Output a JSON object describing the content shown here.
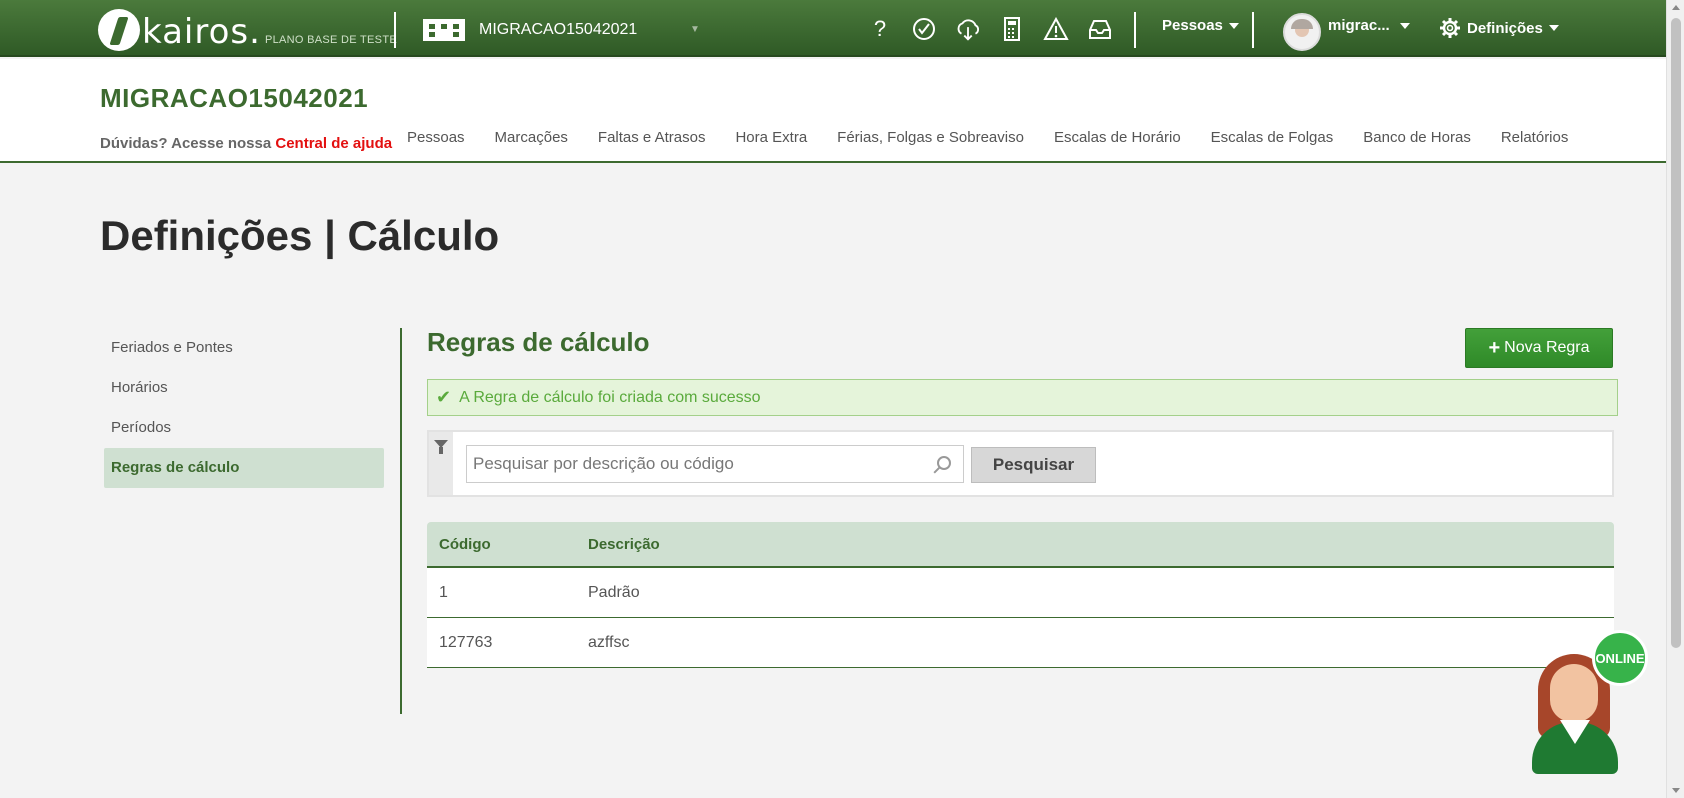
{
  "topbar": {
    "logo_text": "kairos.",
    "logo_sub": "PLANO BASE DE TESTE",
    "company": "MIGRACAO15042021",
    "icons": [
      "help-icon",
      "clock-check-icon",
      "cloud-download-icon",
      "calculator-icon",
      "warning-icon",
      "inbox-icon"
    ],
    "pessoas_menu": "Pessoas",
    "user_name": "migrac...",
    "settings_menu": "Definições"
  },
  "header": {
    "company_title": "MIGRACAO15042021",
    "help_prefix": "Dúvidas? Acesse nossa",
    "help_link": "Central de ajuda",
    "nav": [
      "Pessoas",
      "Marcações",
      "Faltas e Atrasos",
      "Hora Extra",
      "Férias, Folgas e Sobreaviso",
      "Escalas de Horário",
      "Escalas de Folgas",
      "Banco de Horas",
      "Relatórios"
    ]
  },
  "page_title": "Definições | Cálculo",
  "sidebar": {
    "items": [
      {
        "label": "Feriados e Pontes"
      },
      {
        "label": "Horários"
      },
      {
        "label": "Períodos"
      },
      {
        "label": "Regras de cálculo"
      }
    ],
    "active_index": 3
  },
  "main": {
    "section_title": "Regras de cálculo",
    "new_button": "Nova Regra",
    "alert": "A Regra de cálculo foi criada com sucesso",
    "search": {
      "placeholder": "Pesquisar por descrição ou código",
      "value": "",
      "button": "Pesquisar"
    },
    "table": {
      "headers": [
        "Código",
        "Descrição"
      ],
      "rows": [
        {
          "code": "1",
          "description": "Padrão"
        },
        {
          "code": "127763",
          "description": "azffsc"
        }
      ]
    }
  },
  "chat_widget": {
    "status": "ONLINE"
  },
  "colors": {
    "brand_green": "#3c6a2f",
    "button_green": "#37a031",
    "alert_bg": "#e5f4da",
    "link_red": "#e31010"
  }
}
